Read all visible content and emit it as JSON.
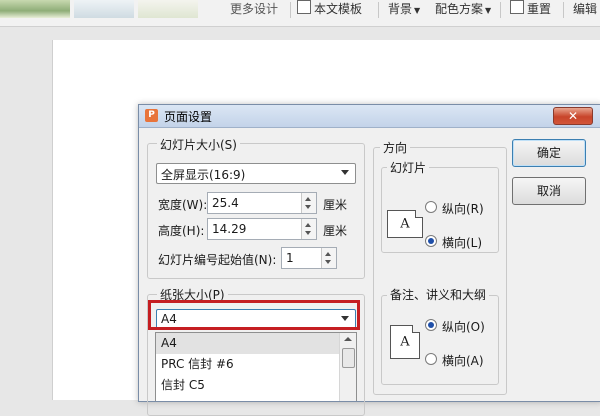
{
  "toolbar": {
    "more_design": "更多设计",
    "template": "本文模板",
    "background": "背景",
    "color_scheme": "配色方案",
    "reset": "重置",
    "edit": "编辑"
  },
  "dialog": {
    "title": "页面设置",
    "close_symbol": "✕",
    "slide_size": {
      "group_label": "幻灯片大小(S)",
      "selected": "全屏显示(16:9)"
    },
    "width": {
      "label": "宽度(W):",
      "value": "25.4",
      "unit": "厘米"
    },
    "height": {
      "label": "高度(H):",
      "value": "14.29",
      "unit": "厘米"
    },
    "start_number": {
      "label": "幻灯片编号起始值(N):",
      "value": "1"
    },
    "orientation": {
      "group_label": "方向",
      "slides": {
        "label": "幻灯片",
        "icon_letter": "A",
        "portrait": "纵向(R)",
        "landscape": "横向(L)",
        "selected": "landscape"
      },
      "notes": {
        "label": "备注、讲义和大纲",
        "icon_letter": "A",
        "portrait": "纵向(O)",
        "landscape": "横向(A)",
        "selected": "portrait"
      }
    },
    "paper_size": {
      "group_label": "纸张大小(P)",
      "selected": "A4",
      "options": [
        "A4",
        "PRC 信封 #6",
        "信封 C5"
      ]
    },
    "ok_label": "确定",
    "cancel_label": "取消"
  },
  "colors": {
    "highlight_box": "#c51e22",
    "title_gradient_top": "#dbe6f4",
    "radio_dot": "#1f4fa8"
  }
}
